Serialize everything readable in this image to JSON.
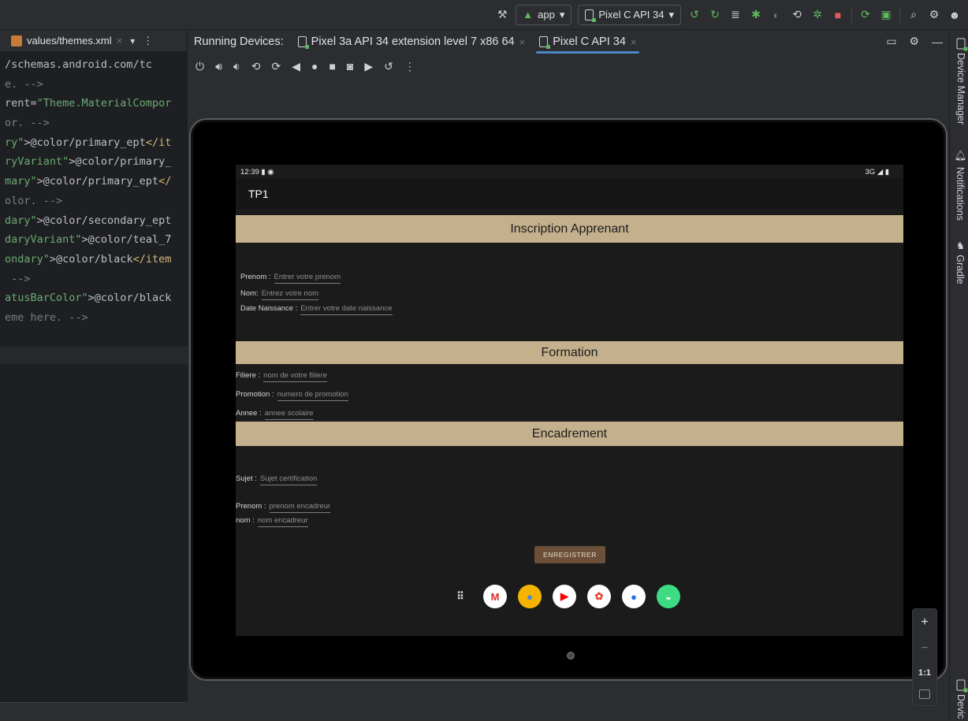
{
  "toolbar": {
    "run_config": "app",
    "device_selector": "Pixel C API 34",
    "icons": [
      "hammer-icon",
      "android-app-icon",
      "device-icon",
      "apply-changes-icon",
      "apply-code-changes-icon",
      "logcat-icon",
      "debug-icon",
      "profiler-icon",
      "attach-icon",
      "bug-icon",
      "stop-icon",
      "sync-icon",
      "device-manager-icon",
      "search-icon",
      "settings-icon",
      "account-icon"
    ]
  },
  "editor": {
    "tab_label": "values/themes.xml",
    "code_lines": [
      [
        {
          "t": "/schemas.android.com/tc",
          "c": "c-attr"
        }
      ],
      [
        {
          "t": "e. -->",
          "c": "c-com"
        }
      ],
      [
        {
          "t": "rent=",
          "c": "c-attr"
        },
        {
          "t": "\"Theme.MaterialCompor",
          "c": "c-str"
        }
      ],
      [
        {
          "t": "or. -->",
          "c": "c-com"
        }
      ],
      [
        {
          "t": "ry\"",
          "c": "c-str"
        },
        {
          "t": ">@color/primary_ept",
          "c": "c-txt"
        },
        {
          "t": "</it",
          "c": "c-tag"
        }
      ],
      [
        {
          "t": "ryVariant\"",
          "c": "c-str"
        },
        {
          "t": ">@color/primary_",
          "c": "c-txt"
        }
      ],
      [
        {
          "t": "mary\"",
          "c": "c-str"
        },
        {
          "t": ">@color/primary_ept",
          "c": "c-txt"
        },
        {
          "t": "</",
          "c": "c-tag"
        }
      ],
      [
        {
          "t": "olor. -->",
          "c": "c-com"
        }
      ],
      [
        {
          "t": "dary\"",
          "c": "c-str"
        },
        {
          "t": ">@color/secondary_ept",
          "c": "c-txt"
        }
      ],
      [
        {
          "t": "daryVariant\"",
          "c": "c-str"
        },
        {
          "t": ">@color/teal_7",
          "c": "c-txt"
        }
      ],
      [
        {
          "t": "ondary\"",
          "c": "c-str"
        },
        {
          "t": ">@color/black",
          "c": "c-txt"
        },
        {
          "t": "</item",
          "c": "c-tag"
        }
      ],
      [
        {
          "t": " -->",
          "c": "c-com"
        }
      ],
      [
        {
          "t": "atusBarColor\"",
          "c": "c-str"
        },
        {
          "t": ">@color/black",
          "c": "c-txt"
        }
      ],
      [
        {
          "t": "eme here. -->",
          "c": "c-com"
        }
      ]
    ]
  },
  "panel": {
    "title": "Running Devices:",
    "tabs": [
      {
        "label": "Pixel 3a API 34 extension level 7 x86 64",
        "active": false
      },
      {
        "label": "Pixel C API 34",
        "active": true
      }
    ]
  },
  "device_toolbar": {
    "icons": [
      "power-icon",
      "volume-up-icon",
      "volume-down-icon",
      "rotate-left-icon",
      "rotate-right-icon",
      "back-icon",
      "home-icon",
      "overview-icon",
      "screenshot-icon",
      "screen-record-icon",
      "reset-icon",
      "more-icon"
    ]
  },
  "app": {
    "status_time": "12:39",
    "status_right": "3G",
    "appbar_title": "TP1",
    "section_inscription": "Inscription Apprenant",
    "section_formation": "Formation",
    "section_encadrement": "Encadrement",
    "prenom_label": "Prenom :",
    "prenom_hint": "Entrer votre prenom",
    "nom_label": "Nom:",
    "nom_hint": "Entrez votre nom",
    "naissance_label": "Date Naissance :",
    "naissance_hint": "Entrer votre date naissance",
    "filiere_label": "Filiere :",
    "filiere_hint": "nom de votre filiere",
    "promotion_label": "Promotion :",
    "promotion_hint": "numero de promotion",
    "annee_label": "Annee :",
    "annee_hint": "annee scolaire",
    "sujet_label": "Sujet :",
    "sujet_hint": "Sujet certification",
    "enc_prenom_label": "Prenom :",
    "enc_prenom_hint": "prenom encadreur",
    "enc_nom_label": "nom :",
    "enc_nom_hint": "nom encadreur",
    "save_button": "ENREGISTRER"
  },
  "dock": {
    "apps": [
      {
        "name": "app-drawer-icon",
        "bg": "transparent",
        "glyph": "⠿",
        "color": "#e0e0e0"
      },
      {
        "name": "gmail-icon",
        "bg": "#ffffff",
        "glyph": "M",
        "color": "#d93025"
      },
      {
        "name": "chrome-icon",
        "bg": "#f4b400",
        "glyph": "●",
        "color": "#4285f4"
      },
      {
        "name": "youtube-icon",
        "bg": "#ffffff",
        "glyph": "▶",
        "color": "#ff0000"
      },
      {
        "name": "photos-icon",
        "bg": "#ffffff",
        "glyph": "✿",
        "color": "#ea4335"
      },
      {
        "name": "messages-icon",
        "bg": "#ffffff",
        "glyph": "●",
        "color": "#1a73e8"
      },
      {
        "name": "android-icon",
        "bg": "#3ddc84",
        "glyph": "◒",
        "color": "#ffffff"
      }
    ]
  },
  "zoom": {
    "plus": "+",
    "minus": "−",
    "one_to_one": "1:1"
  },
  "sidebar": {
    "device_manager": "Device Manager",
    "notifications": "Notifications",
    "gradle": "Gradle",
    "bottom": "Devic"
  }
}
